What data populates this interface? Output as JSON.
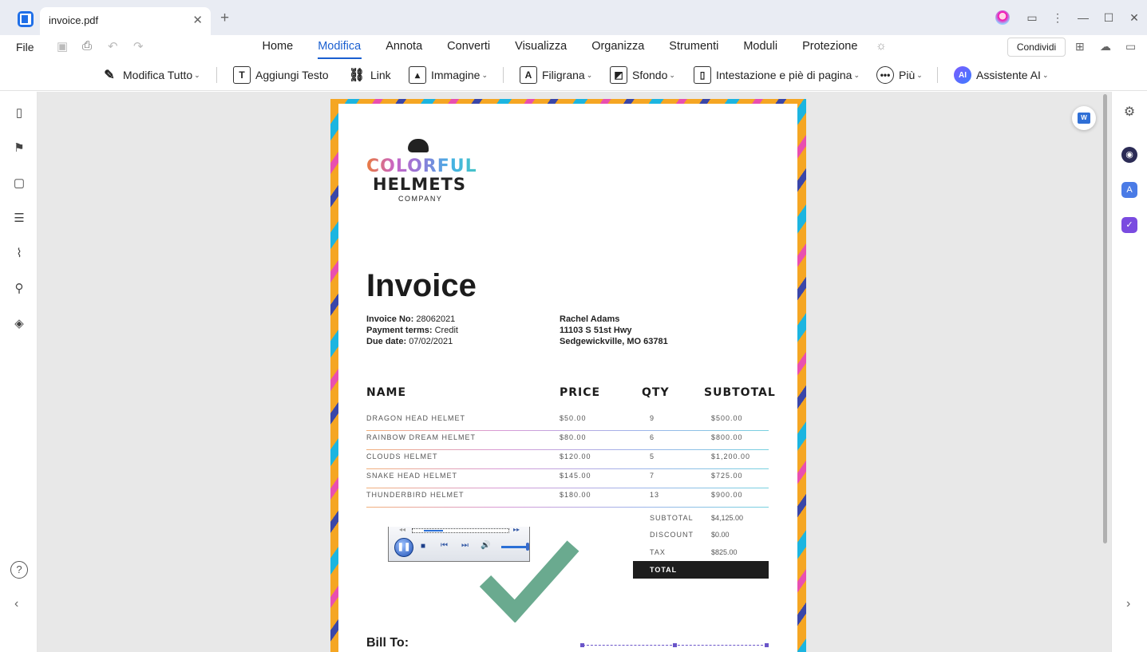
{
  "window": {
    "tab_title": "invoice.pdf",
    "tab_close": "✕",
    "new_tab": "+"
  },
  "menubar": {
    "file": "File",
    "tabs": [
      "Home",
      "Modifica",
      "Annota",
      "Converti",
      "Visualizza",
      "Organizza",
      "Strumenti",
      "Moduli",
      "Protezione"
    ],
    "active_tab": "Modifica",
    "share": "Condividi"
  },
  "toolbar": {
    "modifica_tutto": "Modifica Tutto",
    "aggiungi_testo": "Aggiungi Testo",
    "link": "Link",
    "immagine": "Immagine",
    "filigrana": "Filigrana",
    "sfondo": "Sfondo",
    "intestazione": "Intestazione e piè di pagina",
    "piu": "Più",
    "assistente": "Assistente AI",
    "ai_badge": "AI"
  },
  "document": {
    "logo": {
      "line1": "COLORFUL",
      "line2": "HELMETS",
      "line3": "COMPANY"
    },
    "title": "Invoice",
    "invoice_no_label": "Invoice No:",
    "invoice_no": "28062021",
    "payment_label": "Payment terms:",
    "payment": "Credit",
    "due_label": "Due date:",
    "due": "07/02/2021",
    "customer_name": "Rachel Adams",
    "customer_addr1": "11103 S 51st Hwy",
    "customer_addr2": "Sedgewickville, MO 63781",
    "headers": {
      "name": "NAME",
      "price": "PRICE",
      "qty": "QTY",
      "subtotal": "SUBTOTAL"
    },
    "rows": [
      {
        "name": "DRAGON HEAD HELMET",
        "price": "$50.00",
        "qty": "9",
        "subtotal": "$500.00"
      },
      {
        "name": "RAINBOW DREAM HELMET",
        "price": "$80.00",
        "qty": "6",
        "subtotal": "$800.00"
      },
      {
        "name": "CLOUDS HELMET",
        "price": "$120.00",
        "qty": "5",
        "subtotal": "$1,200.00"
      },
      {
        "name": "SNAKE HEAD HELMET",
        "price": "$145.00",
        "qty": "7",
        "subtotal": "$725.00"
      },
      {
        "name": "THUNDERBIRD HELMET",
        "price": "$180.00",
        "qty": "13",
        "subtotal": "$900.00"
      }
    ],
    "summary": {
      "subtotal_label": "SUBTOTAL",
      "subtotal": "$4,125.00",
      "discount_label": "DISCOUNT",
      "discount": "$0.00",
      "tax_label": "TAX",
      "tax": "$825.00",
      "total_label": "TOTAL"
    },
    "bill_to": "Bill To:"
  },
  "colors": {
    "accent": "#1a5fd0",
    "checkmark": "#6aaa8f",
    "total_bar": "#1d1d1d"
  }
}
